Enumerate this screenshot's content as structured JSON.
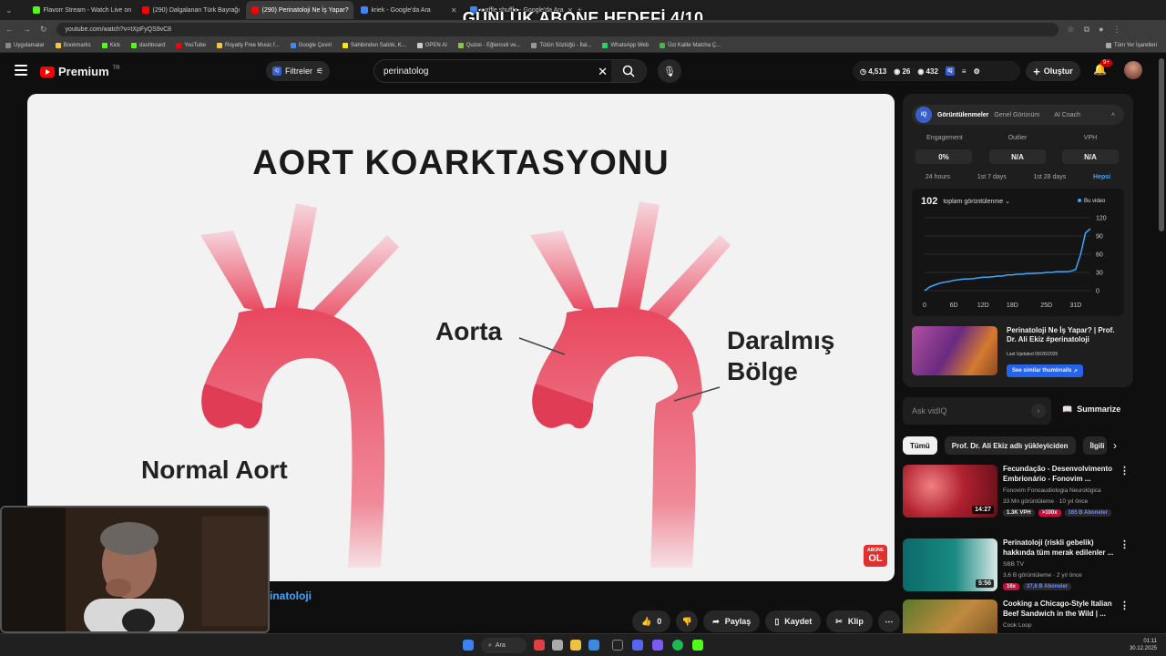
{
  "overlay": {
    "title": "GÜNLÜK ABONE HEDEFİ 4/10"
  },
  "browser": {
    "tabs": [
      {
        "label": "Flavorr Stream - Watch Live on",
        "color": "#53fc18",
        "active": false
      },
      {
        "label": "(290) Dalgalanan Türk Bayrağı",
        "color": "#ff0000",
        "active": false
      },
      {
        "label": "(290) Perinatoloji Ne İş Yapar?",
        "color": "#ff0000",
        "active": true
      },
      {
        "label": "kriek - Google'da Ara",
        "color": "#4285f4",
        "active": false
      },
      {
        "label": "waffle shuffle - Google'da Ara",
        "color": "#4285f4",
        "active": false
      }
    ],
    "url": "youtube.com/watch?v=tXpFyQS9vC8",
    "bookmarks": [
      {
        "label": "Uygulamalar",
        "color": "#888"
      },
      {
        "label": "Bookmarks",
        "color": "#f5c542"
      },
      {
        "label": "Kick",
        "color": "#53fc18"
      },
      {
        "label": "dashboard",
        "color": "#53fc18"
      },
      {
        "label": "YouTube",
        "color": "#ff0000"
      },
      {
        "label": "Royalty Free Music f...",
        "color": "#f5c542"
      },
      {
        "label": "Google Çeviri",
        "color": "#4285f4"
      },
      {
        "label": "Sahibinden Satılık, K...",
        "color": "#ffe800"
      },
      {
        "label": "OPEN AI",
        "color": "#ccc"
      },
      {
        "label": "Quizei - Eğlenceli ve...",
        "color": "#8bc34a"
      },
      {
        "label": "Tütün Sözlüğü - İtal...",
        "color": "#999"
      },
      {
        "label": "WhatsApp Web",
        "color": "#25d366"
      },
      {
        "label": "Üst Kalite Matcha Ç...",
        "color": "#4caf50"
      }
    ],
    "all_bookmarks": "Tüm Yer İşaretleri"
  },
  "yt": {
    "logo": "Premium",
    "country": "TR",
    "filters": "Filtreler",
    "search_value": "perinatolog",
    "stats": {
      "a": "4,513",
      "b": "26",
      "c": "432"
    },
    "create": "Oluştur",
    "notif_badge": "9+"
  },
  "video": {
    "title": "AORT KOARKTASYONU",
    "label_normal": "Normal Aort",
    "label_aorta": "Aorta",
    "label_narrow_1": "Daralmış",
    "label_narrow_2": "Bölge",
    "abone_top": "ABONE",
    "abone_bottom": "OL"
  },
  "below_title": "inatoloji",
  "actions": {
    "likes": "0",
    "share": "Paylaş",
    "save": "Kaydet",
    "clip": "Klip"
  },
  "vidiq": {
    "tabs": [
      "Görüntülenmeler",
      "Genel Görünüm",
      "AI Coach"
    ],
    "metrics": [
      {
        "label": "Engagement",
        "value": "0%"
      },
      {
        "label": "Outlier",
        "value": "N/A"
      },
      {
        "label": "VPH",
        "value": "N/A"
      }
    ],
    "periods": [
      "24 hours",
      "1st 7 days",
      "1st 28 days",
      "Hepsi"
    ],
    "total": "102",
    "total_label": "toplam görüntülenme",
    "legend": "Bu video",
    "card_title": "Perinatoloji Ne İş Yapar? | Prof. Dr. Ali Ekiz #perinatoloji",
    "card_updated": "Last Updated 09/26/2025",
    "card_button": "See similar thumbnails"
  },
  "chart_data": {
    "type": "line",
    "x_ticks": [
      "0",
      "6D",
      "12D",
      "18D",
      "25D",
      "31D"
    ],
    "y_ticks": [
      "120",
      "90",
      "60",
      "30",
      "0"
    ],
    "ylim": [
      0,
      120
    ],
    "xlim": [
      0,
      34
    ],
    "series": [
      {
        "name": "Bu video",
        "x": [
          0,
          1,
          2,
          3,
          4,
          5,
          6,
          7,
          8,
          9,
          10,
          11,
          12,
          13,
          14,
          15,
          16,
          17,
          18,
          19,
          20,
          21,
          22,
          23,
          24,
          25,
          26,
          27,
          28,
          29,
          30,
          31,
          32,
          33,
          34
        ],
        "y": [
          0,
          6,
          9,
          12,
          14,
          15,
          17,
          18,
          19,
          19,
          20,
          21,
          22,
          22,
          23,
          24,
          24,
          26,
          26,
          27,
          27,
          28,
          28,
          29,
          29,
          30,
          30,
          31,
          31,
          31,
          32,
          35,
          60,
          95,
          102
        ]
      }
    ]
  },
  "ask": {
    "placeholder": "Ask vidIQ",
    "summarize": "Summarize"
  },
  "chips": [
    "Tümü",
    "Prof. Dr. Ali Ekiz adlı yükleyiciden",
    "İlgili"
  ],
  "recs": [
    {
      "title": "Fecundação - Desenvolvimento Embrionário - Fonovim ...",
      "channel": "Fonovim Fonoaudiologia Neurológica",
      "meta": "33 Mn görüntüleme · 10 yıl önce",
      "duration": "14:27",
      "tags": [
        "1.3K VPH",
        ">100x",
        "165 B Aboneler"
      ]
    },
    {
      "title": "Perinatoloji (riskli gebelik) hakkında tüm merak edilenler ...",
      "channel": "SBB TV",
      "meta": "3,6 B görüntüleme · 2 yıl önce",
      "duration": "5:56",
      "tags": [
        "16x",
        "37,6 B Aboneler"
      ]
    },
    {
      "title": "Cooking a Chicago-Style Italian Beef Sandwich in the Wild | ...",
      "channel": "Cook Loop",
      "meta": "",
      "duration": "",
      "tags": []
    }
  ],
  "taskbar": {
    "search": "Ara",
    "time": "01:11",
    "date": "30.12.2025"
  }
}
